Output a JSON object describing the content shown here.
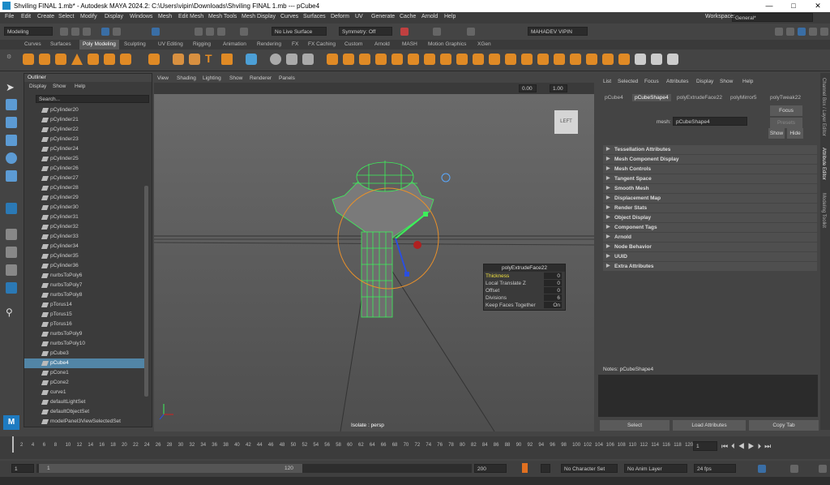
{
  "title_bar": {
    "text": "Shviling FINAL 1.mb* - Autodesk MAYA 2024.2: C:\\Users\\vipin\\Downloads\\Shviling FINAL 1.mb  ---  pCube4"
  },
  "menu": [
    "File",
    "Edit",
    "Create",
    "Select",
    "Modify",
    "Display",
    "Windows",
    "Mesh",
    "Edit Mesh",
    "Mesh Tools",
    "Mesh Display",
    "Curves",
    "Surfaces",
    "Deform",
    "UV",
    "Generate",
    "Cache",
    "Arnold",
    "Help"
  ],
  "workspace": {
    "label": "Workspace:",
    "value": "General*"
  },
  "status_line": {
    "mode": "Modeling",
    "live_surface": "No Live Surface",
    "symmetry": "Symmetry: Off",
    "user": "MAHADEV VIPIN"
  },
  "shelf_tabs": [
    "Curves",
    "Surfaces",
    "Poly Modeling",
    "Sculpting",
    "UV Editing",
    "Rigging",
    "Animation",
    "Rendering",
    "FX",
    "FX Caching",
    "Custom",
    "Arnold",
    "MASH",
    "Motion Graphics",
    "XGen"
  ],
  "shelf_active": "Poly Modeling",
  "outliner": {
    "title": "Outliner",
    "menu": [
      "Display",
      "Show",
      "Help"
    ],
    "search_placeholder": "Search...",
    "items": [
      "pCylinder20",
      "pCylinder21",
      "pCylinder22",
      "pCylinder23",
      "pCylinder24",
      "pCylinder25",
      "pCylinder26",
      "pCylinder27",
      "pCylinder28",
      "pCylinder29",
      "pCylinder30",
      "pCylinder31",
      "pCylinder32",
      "pCylinder33",
      "pCylinder34",
      "pCylinder35",
      "pCylinder36",
      "nurbsToPoly6",
      "nurbsToPoly7",
      "nurbsToPoly8",
      "pTorus14",
      "pTorus15",
      "pTorus16",
      "nurbsToPoly9",
      "nurbsToPoly10",
      "pCube3",
      "pCube4",
      "pCone1",
      "pCone2",
      "curve1",
      "defaultLightSet",
      "defaultObjectSet",
      "modelPanel3ViewSelectedSet"
    ],
    "selected": "pCube4"
  },
  "viewport": {
    "menu": [
      "View",
      "Shading",
      "Lighting",
      "Show",
      "Renderer",
      "Panels"
    ],
    "field1": "0.00",
    "field2": "1.00",
    "cube_label": "LEFT",
    "isolate_label": "Isolate : persp",
    "popup": {
      "title": "polyExtrudeFace22",
      "rows": [
        {
          "label": "Thickness",
          "value": "0",
          "highlight": true
        },
        {
          "label": "Local Translate Z",
          "value": "0"
        },
        {
          "label": "Offset",
          "value": "0"
        },
        {
          "label": "Divisions",
          "value": "6"
        },
        {
          "label": "Keep Faces Together",
          "value": "On"
        }
      ]
    }
  },
  "attr_editor": {
    "menu": [
      "List",
      "Selected",
      "Focus",
      "Attributes",
      "Display",
      "Show",
      "Help"
    ],
    "tabs": [
      "pCube4",
      "pCubeShape4",
      "polyExtrudeFace22",
      "polyMirror5",
      "polyTweak22"
    ],
    "active_tab": "pCubeShape4",
    "mesh_label": "mesh:",
    "mesh_value": "pCubeShape4",
    "focus": "Focus",
    "presets": "Presets",
    "show": "Show",
    "hide": "Hide",
    "sections": [
      "Tessellation Attributes",
      "Mesh Component Display",
      "Mesh Controls",
      "Tangent Space",
      "Smooth Mesh",
      "Displacement Map",
      "Render Stats",
      "Object Display",
      "Component Tags",
      "Arnold",
      "Node Behavior",
      "UUID",
      "Extra Attributes"
    ],
    "notes": "Notes:  pCubeShape4",
    "buttons": [
      "Select",
      "Load Attributes",
      "Copy Tab"
    ]
  },
  "side_tabs": [
    "Channel Box / Layer Editor",
    "Attribute Editor",
    "Modeling Toolkit"
  ],
  "timeline": {
    "ticks": [
      "2",
      "4",
      "6",
      "8",
      "10",
      "12",
      "14",
      "16",
      "18",
      "20",
      "22",
      "24",
      "26",
      "28",
      "30",
      "32",
      "34",
      "36",
      "38",
      "40",
      "42",
      "44",
      "46",
      "48",
      "50",
      "52",
      "54",
      "56",
      "58",
      "60",
      "62",
      "64",
      "66",
      "68",
      "70",
      "72",
      "74",
      "76",
      "78",
      "80",
      "82",
      "84",
      "86",
      "88",
      "90",
      "92",
      "94",
      "96",
      "98",
      "100",
      "102",
      "104",
      "106",
      "108",
      "110",
      "112",
      "114",
      "116",
      "118",
      "120"
    ],
    "current": "1"
  },
  "range": {
    "start": "1",
    "inner_start": "1",
    "inner_end": "120",
    "end": "120",
    "end2": "200",
    "character_set": "No Character Set",
    "anim_layer": "No Anim Layer",
    "fps": "24 fps"
  }
}
